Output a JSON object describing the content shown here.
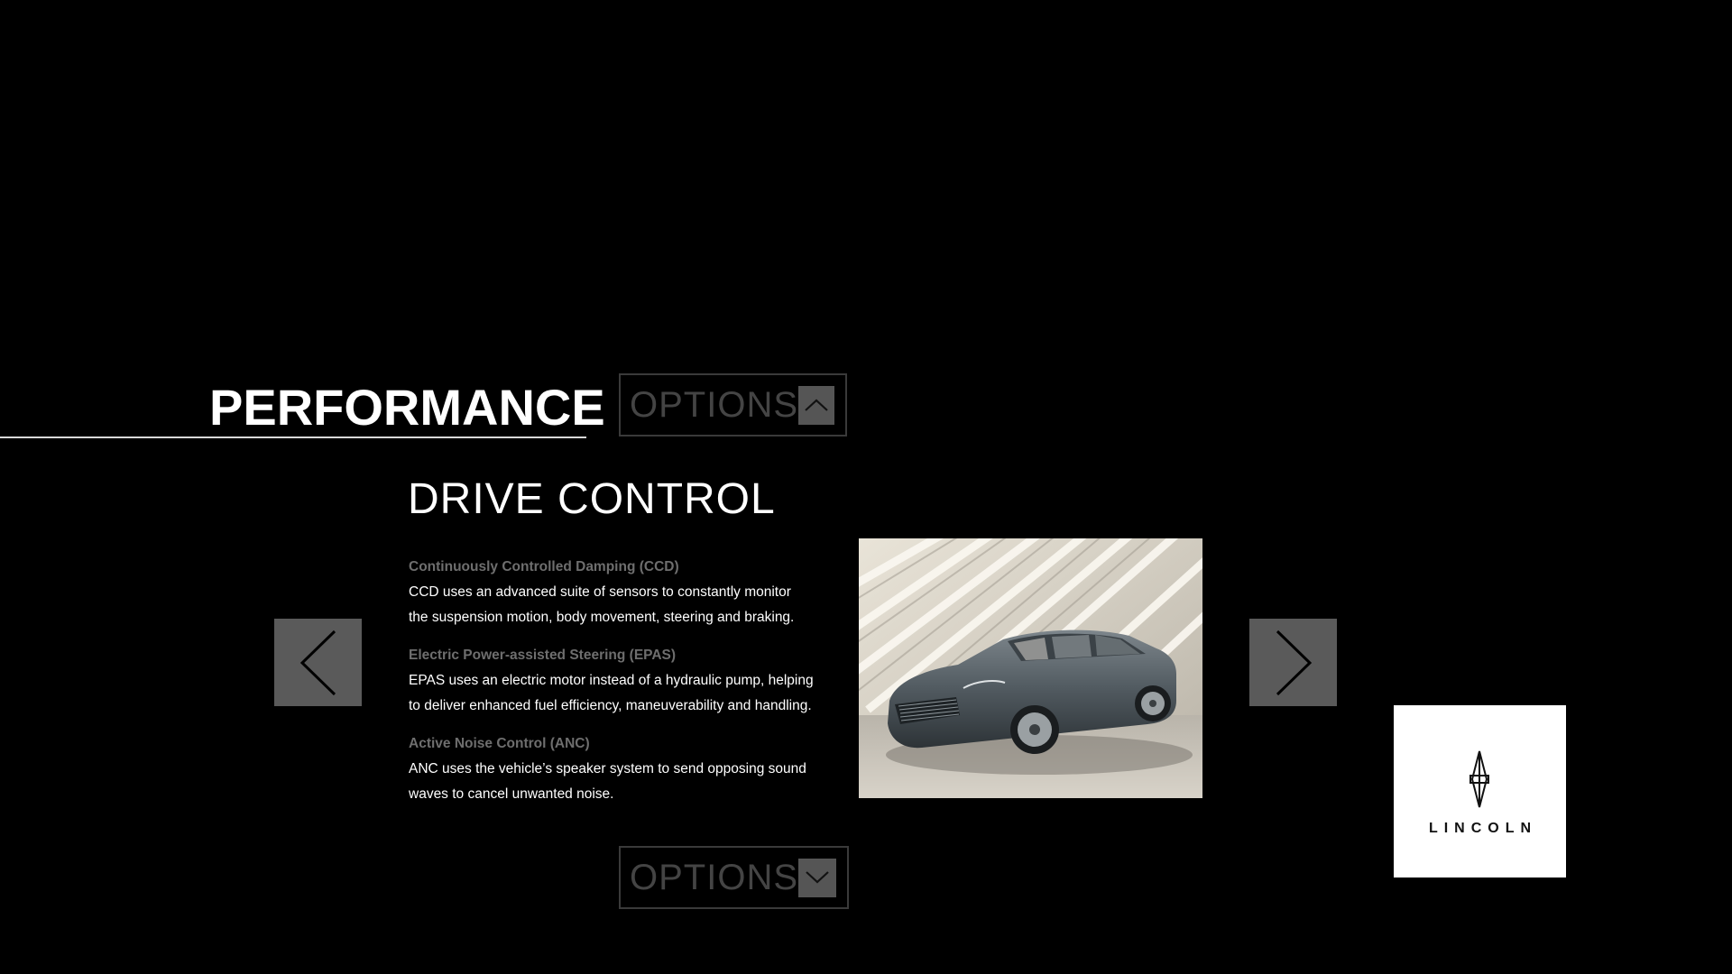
{
  "section": {
    "title": "PERFORMANCE"
  },
  "options_top": {
    "label": "OPTIONS",
    "caret_icon": "chevron-up-icon"
  },
  "options_bottom": {
    "label": "OPTIONS",
    "caret_icon": "chevron-down-icon"
  },
  "content": {
    "heading": "DRIVE CONTROL",
    "features": [
      {
        "title": "Continuously Controlled Damping (CCD)",
        "lines": [
          "CCD uses an advanced suite of sensors to constantly monitor",
          "the suspension motion, body movement, steering and braking."
        ]
      },
      {
        "title": "Electric Power-assisted Steering (EPAS)",
        "lines": [
          "EPAS uses an electric motor instead of a hydraulic pump, helping",
          "to deliver enhanced fuel efficiency, maneuverability and handling."
        ]
      },
      {
        "title": "Active Noise Control (ANC)",
        "lines": [
          "ANC uses the vehicle’s speaker system to send opposing sound",
          "waves to cancel unwanted noise."
        ]
      }
    ]
  },
  "navigation": {
    "prev_icon": "chevron-left-icon",
    "next_icon": "chevron-right-icon"
  },
  "brand": {
    "wordmark": "LINCOLN",
    "logo_icon": "lincoln-star-icon"
  },
  "colors": {
    "background": "#000000",
    "nav_button": "#5a5a5a",
    "options_border": "#3a3a3a",
    "options_text": "#444444",
    "feature_title": "#6e6e6e"
  }
}
